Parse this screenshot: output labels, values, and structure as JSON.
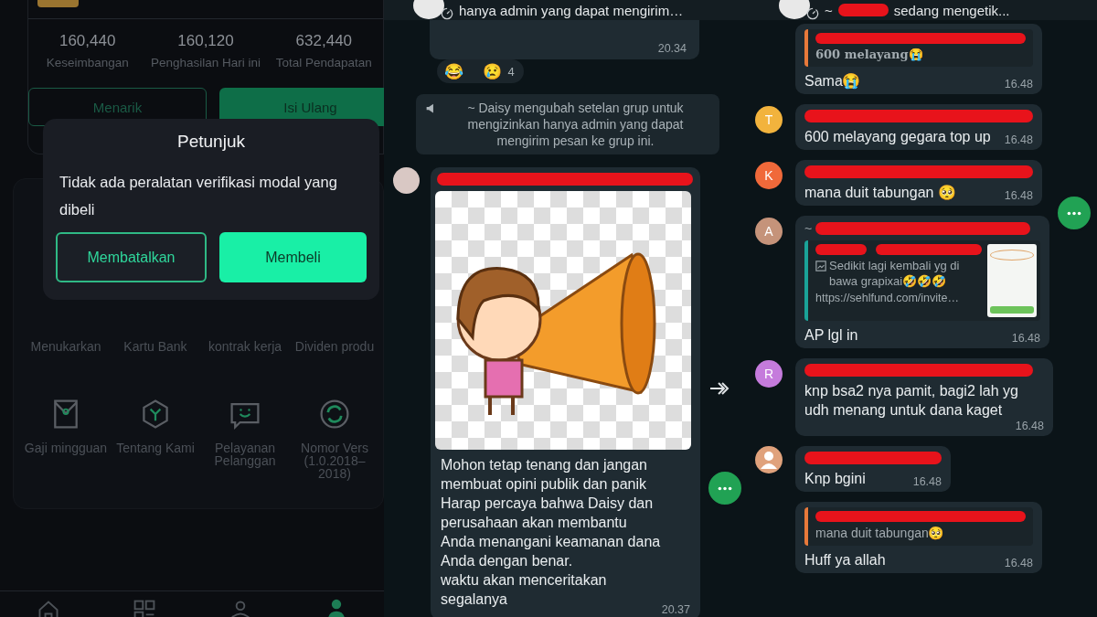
{
  "finance_app": {
    "stats": [
      {
        "value": "160,440",
        "label": "Keseimbangan"
      },
      {
        "value": "160,120",
        "label": "Penghasilan Hari ini"
      },
      {
        "value": "632,440",
        "label": "Total Pendapatan"
      }
    ],
    "actions": [
      {
        "label": "Menarik",
        "kind": "outline"
      },
      {
        "label": "Isi Ulang",
        "kind": "filled"
      }
    ],
    "menu_row_1": [
      "Menukarkan",
      "Kartu Bank",
      "kontrak kerja",
      "Dividen produ"
    ],
    "menu_row_2": [
      {
        "kind": "envelope",
        "label": "Gaji mingguan"
      },
      {
        "kind": "hexagon",
        "label": "Tentang Kami"
      },
      {
        "kind": "chat",
        "label": "Pelayanan Pelanggan"
      },
      {
        "kind": "refresh",
        "label": "Nomor Vers\n(1.0.2018–\n2018)"
      }
    ],
    "bottom_nav": [
      {
        "kind": "home",
        "selected": false
      },
      {
        "kind": "grid",
        "selected": false
      },
      {
        "kind": "people",
        "selected": false
      },
      {
        "kind": "person",
        "selected": true
      }
    ],
    "dialog": {
      "title": "Petunjuk",
      "message": "Tidak ada peralatan verifikasi modal yang dibeli",
      "buttons": [
        {
          "label": "Membatalkan",
          "kind": "outline"
        },
        {
          "label": "Membeli",
          "kind": "filled"
        }
      ]
    }
  },
  "chat_1": {
    "header_status": "hanya admin yang dapat mengirim…",
    "messages": [
      {
        "kind": "partial",
        "time": "20.34",
        "reactions": "😂 😢",
        "reaction_count": "4"
      },
      {
        "kind": "system",
        "text": "~ Daisy mengubah setelan grup untuk mengizinkan hanya admin yang dapat mengirim pesan ke grup ini."
      },
      {
        "kind": "sticker",
        "text": "Mohon tetap tenang dan jangan\nmembuat opini publik dan panik\nHarap percaya bahwa Daisy dan\nperusahaan akan membantu\nAnda menangani keamanan dana\nAnda dengan benar.\nwaktu akan menceritakan\nsegalanya",
        "time": "20.37"
      }
    ]
  },
  "chat_2": {
    "header_prefix": "~",
    "header_status": "sedang mengetik...",
    "messages": [
      {
        "kind": "quote",
        "quote_text": "600 melayang😭",
        "text": "Sama😭",
        "time": "16.48"
      },
      {
        "kind": "text",
        "avatar": "T",
        "color": "#f2b33d",
        "text": "600 melayang gegara top up",
        "time": "16.48"
      },
      {
        "kind": "text",
        "avatar": "K",
        "color": "#f0693a",
        "text": "mana duit tabungan 🥺",
        "time": "16.48"
      },
      {
        "kind": "link",
        "avatar": "A",
        "color": "#c5937a",
        "sender_prefix": "~",
        "preview_text": "Sedikit lagi kembali yg di bawa grapixai🤣🤣🤣",
        "link": "https://sehlfund.com/invite…",
        "text": "AP lgl in",
        "time": "16.48"
      },
      {
        "kind": "text",
        "avatar": "R",
        "color": "#c57bdc",
        "text": "knp bsa2 nya pamit, bagi2 lah yg udh menang untuk dana kaget",
        "time": "16.48"
      },
      {
        "kind": "text",
        "color": "#e0a27c",
        "text": "Knp bgini",
        "time": "16.48"
      },
      {
        "kind": "quote",
        "quote_text": "mana duit tabungan🥺",
        "text": "Huff ya allah",
        "time": "16.48"
      }
    ]
  }
}
